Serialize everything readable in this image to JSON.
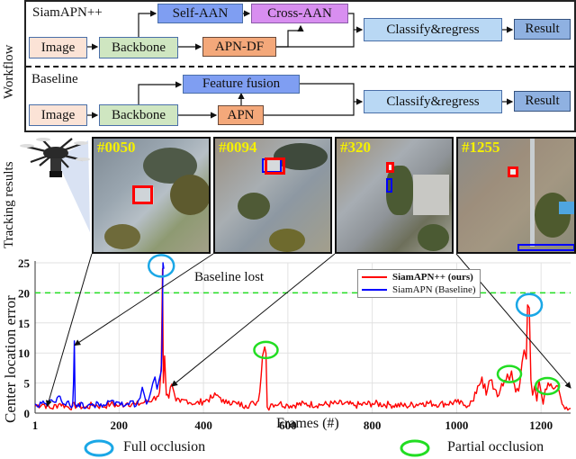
{
  "workflow": {
    "side_label": "Workflow",
    "siamapn": {
      "title": "SiamAPN++",
      "boxes": {
        "image": "Image",
        "backbone": "Backbone",
        "self_aan": "Self-AAN",
        "cross_aan": "Cross-AAN",
        "apn_df": "APN-DF",
        "classify": "Classify&regress",
        "result": "Result"
      }
    },
    "baseline": {
      "title": "Baseline",
      "boxes": {
        "image": "Image",
        "backbone": "Backbone",
        "feature_fusion": "Feature fusion",
        "apn": "APN",
        "classify": "Classify&regress",
        "result": "Result"
      }
    }
  },
  "tracking": {
    "side_label": "Tracking results",
    "frames": [
      {
        "label": "#0050"
      },
      {
        "label": "#0094"
      },
      {
        "label": "#320"
      },
      {
        "label": "#1255"
      }
    ]
  },
  "colors": {
    "ours": "#ff0000",
    "baseline": "#0000ff",
    "threshold": "#22dd22",
    "full_occlusion": "#1aa7e6",
    "partial_occlusion": "#22dd22",
    "frame_number": "#f5f000"
  },
  "chart_data": {
    "type": "line",
    "title": "",
    "xlabel": "Frames (#)",
    "ylabel": "Center location error",
    "xlim": [
      1,
      1270
    ],
    "ylim": [
      0,
      25
    ],
    "xticks": [
      "1",
      "200",
      "400",
      "600",
      "800",
      "1000",
      "1200"
    ],
    "xtick_values": [
      1,
      200,
      400,
      600,
      800,
      1000,
      1200
    ],
    "yticks": [
      "0",
      "5",
      "10",
      "15",
      "20",
      "25"
    ],
    "ytick_values": [
      0,
      5,
      10,
      15,
      20,
      25
    ],
    "grid": true,
    "threshold": {
      "value": 20,
      "label": "Baseline lost"
    },
    "legend": {
      "placement": "top-right",
      "entries": [
        {
          "name": "SiamAPN++ (ours)",
          "bold": true
        },
        {
          "name": "SiamAPN (Baseline)",
          "bold": false
        }
      ]
    },
    "series": [
      {
        "name": "SiamAPN++ (ours)",
        "x": [
          1,
          20,
          40,
          60,
          80,
          100,
          120,
          140,
          160,
          180,
          200,
          220,
          240,
          260,
          280,
          290,
          296,
          300,
          303,
          305,
          308,
          312,
          318,
          325,
          330,
          335,
          345,
          360,
          380,
          400,
          420,
          430,
          440,
          450,
          460,
          480,
          500,
          520,
          530,
          540,
          545,
          548,
          551,
          555,
          560,
          580,
          600,
          640,
          680,
          720,
          760,
          800,
          840,
          880,
          920,
          960,
          1000,
          1020,
          1040,
          1050,
          1060,
          1070,
          1080,
          1090,
          1100,
          1110,
          1120,
          1125,
          1130,
          1140,
          1150,
          1155,
          1160,
          1165,
          1168,
          1172,
          1176,
          1180,
          1185,
          1190,
          1195,
          1200,
          1205,
          1210,
          1220,
          1230,
          1240,
          1245,
          1250,
          1260,
          1270
        ],
        "y": [
          1.2,
          1.5,
          0.8,
          1.6,
          1.0,
          1.3,
          0.9,
          1.4,
          1.1,
          1.5,
          1.2,
          1.7,
          1.4,
          1.8,
          2.3,
          2.8,
          3.5,
          8.0,
          24.0,
          5.0,
          9.5,
          3.0,
          2.5,
          4.8,
          3.5,
          2.0,
          1.8,
          2.2,
          1.5,
          2.0,
          2.5,
          3.0,
          2.6,
          1.6,
          2.0,
          1.5,
          1.3,
          1.6,
          2.0,
          9.5,
          11.0,
          10.0,
          1.0,
          0.5,
          1.5,
          1.6,
          1.3,
          1.5,
          1.4,
          1.6,
          1.3,
          1.6,
          1.4,
          1.2,
          1.7,
          1.5,
          1.8,
          1.3,
          2.0,
          4.5,
          6.0,
          3.0,
          5.5,
          4.0,
          3.0,
          4.5,
          6.5,
          5.5,
          7.0,
          3.5,
          5.0,
          8.5,
          10.5,
          9.0,
          18.0,
          17.5,
          5.5,
          3.0,
          4.5,
          2.0,
          5.5,
          3.5,
          1.5,
          4.0,
          4.5,
          4.0,
          4.5,
          3.0,
          1.5,
          1.0,
          0.8
        ]
      },
      {
        "name": "SiamAPN (Baseline)",
        "x": [
          1,
          10,
          20,
          30,
          40,
          50,
          60,
          70,
          80,
          90,
          92,
          94,
          96,
          100,
          110,
          120,
          130,
          140,
          150,
          160,
          170,
          180,
          190,
          200,
          210,
          220,
          230,
          240,
          250,
          255,
          260,
          265,
          270,
          275,
          280,
          285,
          290,
          295,
          300,
          302,
          304,
          306
        ],
        "y": [
          1.5,
          1.0,
          2.0,
          1.2,
          2.2,
          1.8,
          2.8,
          1.5,
          2.0,
          1.2,
          5.0,
          12.0,
          1.5,
          1.0,
          1.8,
          0.8,
          1.5,
          1.2,
          1.7,
          1.0,
          1.4,
          2.0,
          1.3,
          1.8,
          1.1,
          1.6,
          2.0,
          1.2,
          2.5,
          4.3,
          3.0,
          1.5,
          2.2,
          3.5,
          5.0,
          6.0,
          4.0,
          5.5,
          7.0,
          12.0,
          25.0,
          24.0
        ]
      }
    ],
    "annotations": [
      {
        "type": "ellipse",
        "kind": "Full occlusion",
        "x": 300,
        "y": 24.5
      },
      {
        "type": "ellipse",
        "kind": "Full occlusion",
        "x": 1172,
        "y": 18
      },
      {
        "type": "ellipse",
        "kind": "Partial occlusion",
        "x": 548,
        "y": 10.5
      },
      {
        "type": "ellipse",
        "kind": "Partial occlusion",
        "x": 1125,
        "y": 6.5
      },
      {
        "type": "ellipse",
        "kind": "Partial occlusion",
        "x": 1215,
        "y": 4.5
      }
    ],
    "bottom_legend": {
      "full_occlusion": "Full occlusion",
      "partial_occlusion": "Partial occlusion"
    }
  }
}
